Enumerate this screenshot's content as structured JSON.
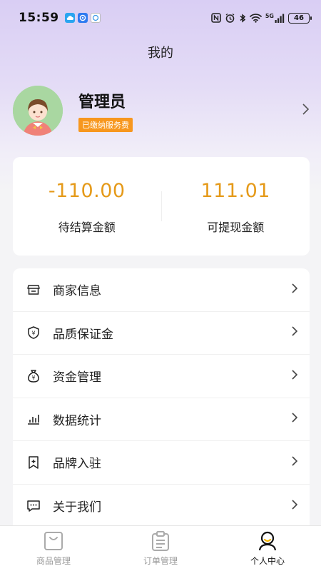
{
  "status_bar": {
    "time": "15:59",
    "network": "5G",
    "battery": "46"
  },
  "header": {
    "title": "我的"
  },
  "profile": {
    "name": "管理员",
    "badge": "已缴纳服务费"
  },
  "balance": {
    "pending_value": "-110.00",
    "pending_label": "待结算金额",
    "withdrawable_value": "111.01",
    "withdrawable_label": "可提现金额"
  },
  "menu": {
    "items": [
      {
        "label": "商家信息",
        "icon": "store-icon"
      },
      {
        "label": "品质保证金",
        "icon": "shield-yen-icon"
      },
      {
        "label": "资金管理",
        "icon": "money-bag-icon"
      },
      {
        "label": "数据统计",
        "icon": "bar-chart-icon"
      },
      {
        "label": "品牌入驻",
        "icon": "bookmark-add-icon"
      },
      {
        "label": "关于我们",
        "icon": "message-dots-icon"
      }
    ]
  },
  "tabs": [
    {
      "label": "商品管理",
      "icon": "bag-icon"
    },
    {
      "label": "订单管理",
      "icon": "clipboard-icon"
    },
    {
      "label": "个人中心",
      "icon": "user-icon",
      "active": true
    }
  ],
  "colors": {
    "accent": "#e59a1a",
    "badge": "#f7971e",
    "header_gradient_top": "#d9cef4"
  }
}
